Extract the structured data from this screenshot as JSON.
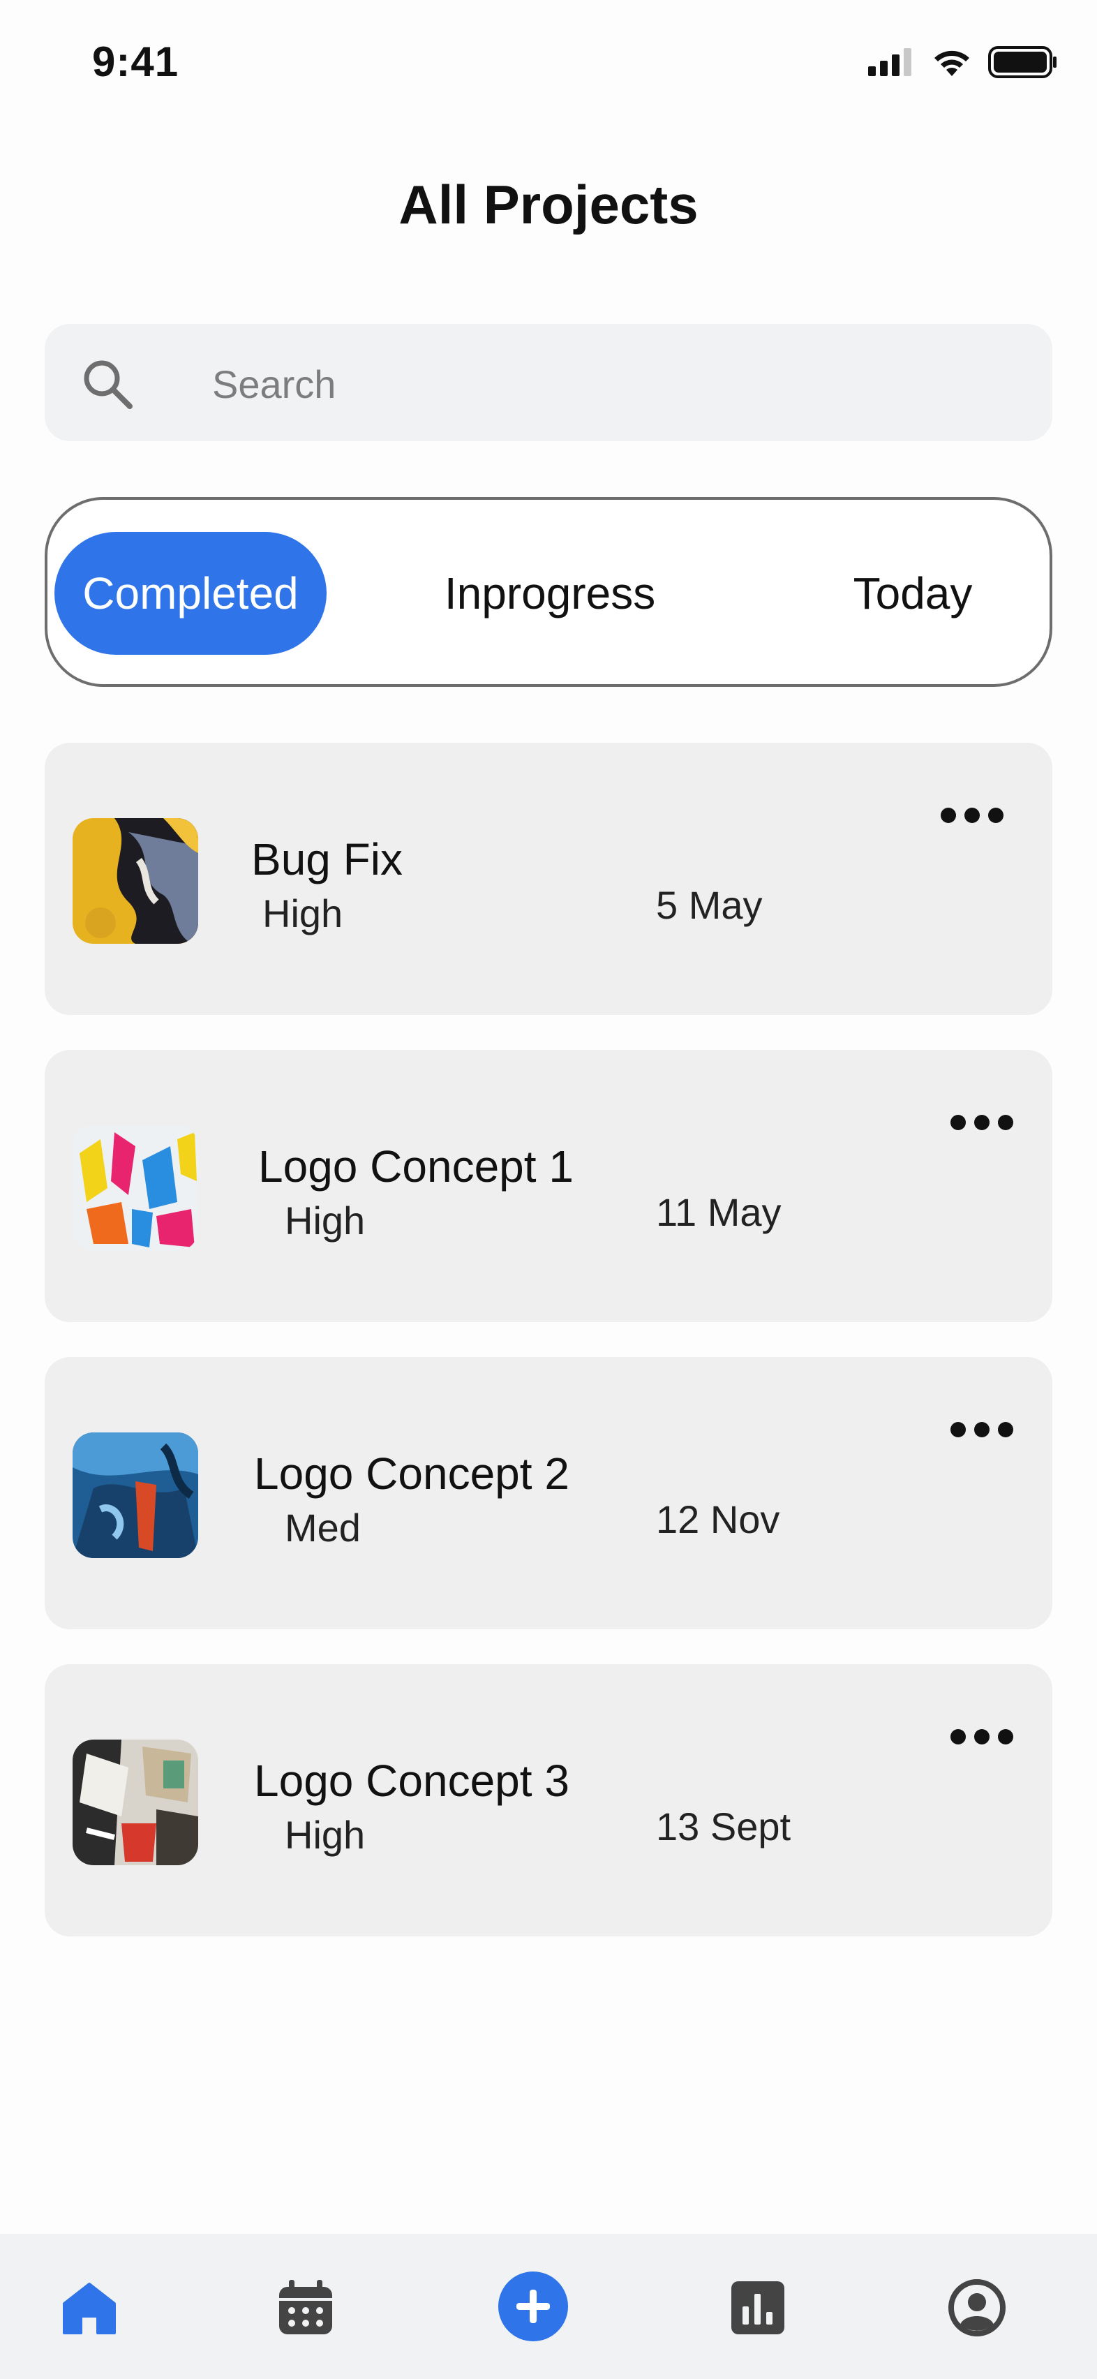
{
  "status_bar": {
    "time": "9:41"
  },
  "header": {
    "title": "All Projects"
  },
  "search": {
    "placeholder": "Search"
  },
  "segments": [
    {
      "label": "Completed",
      "active": true
    },
    {
      "label": "Inprogress",
      "active": false
    },
    {
      "label": "Today",
      "active": false
    }
  ],
  "projects": [
    {
      "title": "Bug Fix",
      "priority": "High",
      "date": "5 May"
    },
    {
      "title": "Logo Concept 1",
      "priority": "High",
      "date": "11 May"
    },
    {
      "title": "Logo Concept 2",
      "priority": "Med",
      "date": "12 Nov"
    },
    {
      "title": "Logo Concept 3",
      "priority": "High",
      "date": "13 Sept"
    }
  ],
  "bottom_nav": {
    "items": [
      {
        "icon": "home-icon",
        "active": true
      },
      {
        "icon": "calendar-icon",
        "active": false
      },
      {
        "icon": "add-icon",
        "active": false
      },
      {
        "icon": "stats-icon",
        "active": false
      },
      {
        "icon": "profile-icon",
        "active": false
      }
    ]
  },
  "colors": {
    "accent": "#2f74e8",
    "card_bg": "#efefef",
    "search_bg": "#f1f2f4",
    "nav_bg": "#f1f2f4"
  }
}
